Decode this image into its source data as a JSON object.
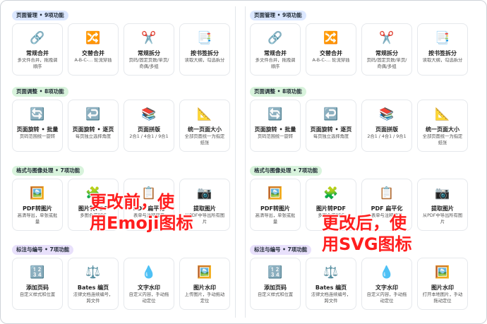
{
  "left": {
    "sections": [
      {
        "label": "页面管理 • 9项功能",
        "color": "blue",
        "cards": [
          {
            "icon": "link-icon",
            "glyph": "🔗",
            "title": "常规合并",
            "desc": "多文件合并，拖拽调顺序"
          },
          {
            "icon": "shuffle-icon",
            "glyph": "🔀",
            "title": "交替合并",
            "desc": "A-B-C-… 轮流穿插"
          },
          {
            "icon": "scissors-icon",
            "glyph": "✂️",
            "title": "常规拆分",
            "desc": "页码/固定页数/单页/奇偶/多组"
          },
          {
            "icon": "bookmark-tabs-icon",
            "glyph": "📑",
            "title": "按书签拆分",
            "desc": "读取大纲，勾选拆分"
          }
        ]
      },
      {
        "label": "页面调整 • 8项功能",
        "color": "green",
        "cards": [
          {
            "icon": "rotate-icon",
            "glyph": "🔄",
            "title": "页面旋转 • 批量",
            "desc": "页码范围统一旋转"
          },
          {
            "icon": "rotate-single-icon",
            "glyph": "↩️",
            "title": "页面旋转 • 逐页",
            "desc": "每页独立选择角度"
          },
          {
            "icon": "books-icon",
            "glyph": "📚",
            "title": "页面拼版",
            "desc": "2合1 / 4合1 / 9合1"
          },
          {
            "icon": "triangle-ruler-icon",
            "glyph": "📐",
            "title": "统一页面大小",
            "desc": "全部页面统一为指定纸张"
          }
        ]
      },
      {
        "label": "格式与图像处理 • 7项功能",
        "color": "green",
        "cards": [
          {
            "icon": "picture-icon",
            "glyph": "🖼️",
            "title": "PDF转图片",
            "desc": "高清导出，单张或批量"
          },
          {
            "icon": "puzzle-icon",
            "glyph": "🧩",
            "title": "图片转PDF",
            "desc": "多图合成PDF"
          },
          {
            "icon": "clipboard-icon",
            "glyph": "📋",
            "title": "PDF 扁平化",
            "desc": "表单与注释扁平"
          },
          {
            "icon": "camera-icon",
            "glyph": "📷",
            "title": "提取图片",
            "desc": "从PDF中导出所有图片"
          }
        ]
      },
      {
        "label": "标注与编号 • 7项功能",
        "color": "purple",
        "cards": [
          {
            "icon": "numbers-icon",
            "glyph": "🔢",
            "title": "添加页码",
            "desc": "自定义样式和位置"
          },
          {
            "icon": "scales-icon",
            "glyph": "⚖️",
            "title": "Bates 编页",
            "desc": "法律文档连续编号，跨文件"
          },
          {
            "icon": "droplet-icon",
            "glyph": "💧",
            "title": "文字水印",
            "desc": "自定义内容，手动拖动定位"
          },
          {
            "icon": "framed-picture-icon",
            "glyph": "🖼️",
            "title": "图片水印",
            "desc": "上传图片，手动拖动定位"
          }
        ]
      }
    ],
    "overlay": "更改前，使\n用Emoji图标"
  },
  "right": {
    "sections": [
      {
        "label": "页面管理 • 9项功能",
        "color": "blue",
        "cards": [
          {
            "icon": "link-icon",
            "glyph": "🔗",
            "title": "常规合并",
            "desc": "多文件合并，拖拽调顺序"
          },
          {
            "icon": "shuffle-icon",
            "glyph": "🔀",
            "title": "交替合并",
            "desc": "A-B-C-… 轮流穿插"
          },
          {
            "icon": "scissors-icon",
            "glyph": "✂️",
            "title": "常规拆分",
            "desc": "页码/固定页数/单页/奇偶/多组"
          },
          {
            "icon": "bookmark-tabs-icon",
            "glyph": "📑",
            "title": "按书签拆分",
            "desc": "读取大纲，勾选拆分"
          }
        ]
      },
      {
        "label": "页面调整 • 8项功能",
        "color": "green",
        "cards": [
          {
            "icon": "rotate-icon",
            "glyph": "🔄",
            "title": "页面旋转 • 批量",
            "desc": "页码范围统一旋转"
          },
          {
            "icon": "rotate-single-icon",
            "glyph": "↩️",
            "title": "页面旋转 • 逐页",
            "desc": "每页独立选择角度"
          },
          {
            "icon": "books-icon",
            "glyph": "📚",
            "title": "页面拼版",
            "desc": "2合1 / 4合1 / 9合1"
          },
          {
            "icon": "triangle-ruler-icon",
            "glyph": "📐",
            "title": "统一页面大小",
            "desc": "全部页面统一为指定纸张"
          }
        ]
      },
      {
        "label": "格式与图像处理 • 7项功能",
        "color": "green",
        "cards": [
          {
            "icon": "picture-icon",
            "glyph": "🖼️",
            "title": "PDF转图片",
            "desc": "高清导出，单张或批量"
          },
          {
            "icon": "puzzle-icon",
            "glyph": "🧩",
            "title": "图片转PDF",
            "desc": "多图合成PDF"
          },
          {
            "icon": "clipboard-icon",
            "glyph": "📋",
            "title": "PDF 扁平化",
            "desc": "表单与注释扁平"
          },
          {
            "icon": "camera-icon",
            "glyph": "📷",
            "title": "提取图片",
            "desc": "从PDF中导出所有图片"
          }
        ]
      },
      {
        "label": "标注与编号 • 7项功能",
        "color": "purple",
        "cards": [
          {
            "icon": "numbers-icon",
            "glyph": "🔢",
            "title": "添加页码",
            "desc": "自定义样式和位置"
          },
          {
            "icon": "scales-icon",
            "glyph": "⚖️",
            "title": "Bates 编页",
            "desc": "法律文档连续编号，跨文件"
          },
          {
            "icon": "droplet-icon",
            "glyph": "💧",
            "title": "文字水印",
            "desc": "自定义内容，手动拖动定位"
          },
          {
            "icon": "framed-picture-icon",
            "glyph": "🖼️",
            "title": "图片水印",
            "desc": "打开本地图片，手动拖动定位"
          }
        ]
      }
    ],
    "overlay": "更改后，使\n用SVG图标"
  },
  "colors": {
    "blue": "#dbe7ff",
    "green": "#d8f3dc",
    "purple": "#e8e0fb",
    "overlay": "#ff1e1e"
  }
}
